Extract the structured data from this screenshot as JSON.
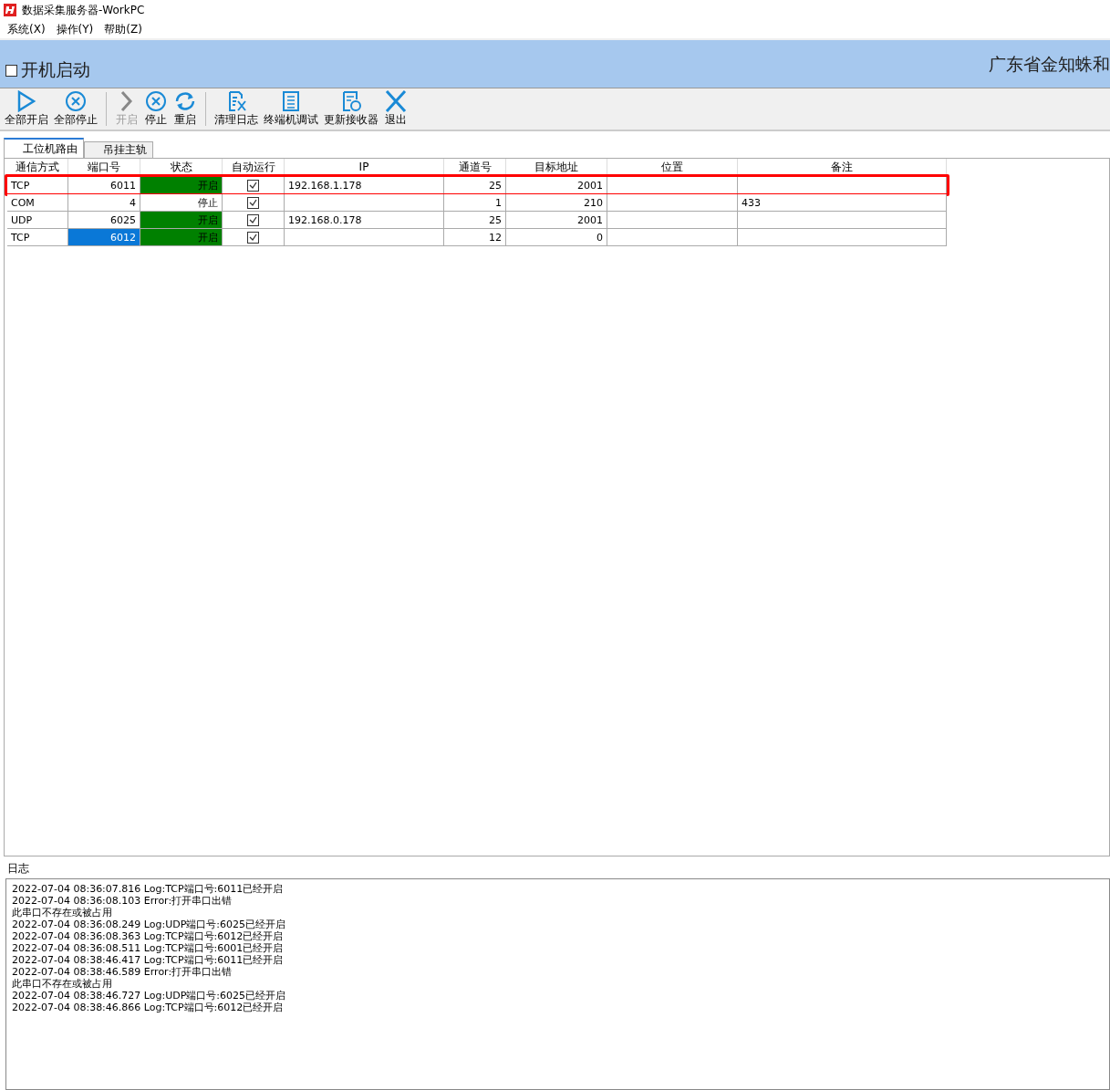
{
  "window": {
    "title": "数据采集服务器-WorkPC"
  },
  "menu": [
    {
      "label": "系统(X)"
    },
    {
      "label": "操作(Y)"
    },
    {
      "label": "帮助(Z)"
    }
  ],
  "banner": {
    "autostart": {
      "label": "开机启动",
      "checked": false
    },
    "company": "广东省金知蛛和"
  },
  "toolbar": [
    {
      "kind": "play",
      "label": "全部开启",
      "disabled": false,
      "separator": false
    },
    {
      "kind": "stop",
      "label": "全部停止",
      "disabled": false,
      "separator": false
    },
    {
      "kind": "next",
      "label": "开启",
      "disabled": true,
      "separator": true
    },
    {
      "kind": "stop",
      "label": "停止",
      "disabled": false,
      "separator": false
    },
    {
      "kind": "restart",
      "label": "重启",
      "disabled": false,
      "separator": false
    },
    {
      "kind": "clear",
      "label": "清理日志",
      "disabled": false,
      "separator": true
    },
    {
      "kind": "list",
      "label": "终端机调试",
      "disabled": false,
      "separator": false
    },
    {
      "kind": "update",
      "label": "更新接收器",
      "disabled": false,
      "separator": false
    },
    {
      "kind": "exit",
      "label": "退出",
      "disabled": false,
      "separator": false
    }
  ],
  "tabs": [
    {
      "label": "工位机路由",
      "selected": true
    },
    {
      "label": "吊挂主轨",
      "selected": false
    }
  ],
  "table": {
    "columns": [
      "通信方式",
      "端口号",
      "状态",
      "自动运行",
      "IP",
      "通道号",
      "目标地址",
      "位置",
      "备注"
    ],
    "rows": [
      {
        "mode": "TCP",
        "port": "6011",
        "status": "开启",
        "running": true,
        "auto": true,
        "ip": "192.168.1.178",
        "channel": "25",
        "target": "2001",
        "position": "",
        "note": "",
        "selected": false,
        "highlighted": true
      },
      {
        "mode": "COM",
        "port": "4",
        "status": "停止",
        "running": false,
        "auto": true,
        "ip": "",
        "channel": "1",
        "target": "210",
        "position": "",
        "note": "433",
        "selected": false,
        "highlighted": false
      },
      {
        "mode": "UDP",
        "port": "6025",
        "status": "开启",
        "running": true,
        "auto": true,
        "ip": "192.168.0.178",
        "channel": "25",
        "target": "2001",
        "position": "",
        "note": "",
        "selected": false,
        "highlighted": false
      },
      {
        "mode": "TCP",
        "port": "6012",
        "status": "开启",
        "running": true,
        "auto": true,
        "ip": "",
        "channel": "12",
        "target": "0",
        "position": "",
        "note": "",
        "selected": true,
        "highlighted": false
      }
    ]
  },
  "log": {
    "title": "日志",
    "lines": [
      "2022-07-04 08:36:07.816 Log:TCP端口号:6011已经开启",
      "2022-07-04 08:36:08.103 Error:打开串口出错",
      "此串口不存在或被占用",
      "2022-07-04 08:36:08.249 Log:UDP端口号:6025已经开启",
      "2022-07-04 08:36:08.363 Log:TCP端口号:6012已经开启",
      "2022-07-04 08:36:08.511 Log:TCP端口号:6001已经开启",
      "2022-07-04 08:38:46.417 Log:TCP端口号:6011已经开启",
      "2022-07-04 08:38:46.589 Error:打开串口出错",
      "此串口不存在或被占用",
      "2022-07-04 08:38:46.727 Log:UDP端口号:6025已经开启",
      "2022-07-04 08:38:46.866 Log:TCP端口号:6012已经开启"
    ]
  }
}
